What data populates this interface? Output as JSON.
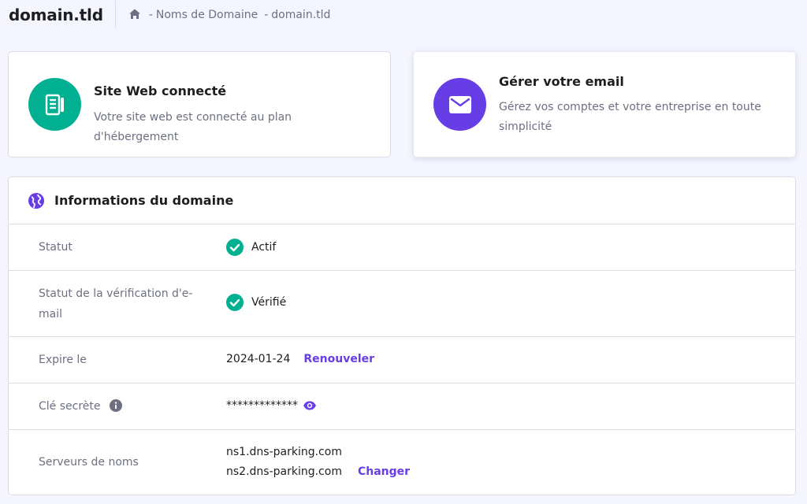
{
  "header": {
    "domain": "domain.tld",
    "breadcrumb": {
      "sep1": "-",
      "section": "Noms de Domaine",
      "sep2": "-",
      "current": "domain.tld"
    }
  },
  "cards": {
    "website": {
      "icon": "server-icon",
      "title": "Site Web connecté",
      "description": "Votre site web est connecté au plan d'hébergement"
    },
    "email": {
      "icon": "mail-icon",
      "title": "Gérer votre email",
      "description": "Gérez vos comptes et votre entreprise en toute simplicité"
    }
  },
  "domain_info": {
    "title": "Informations du domaine",
    "status": {
      "label": "Statut",
      "value": "Actif"
    },
    "email_verification": {
      "label": "Statut de la vérification d'e-mail",
      "value": "Vérifié"
    },
    "expiry": {
      "label": "Expire le",
      "value": "2024-01-24",
      "action": "Renouveler"
    },
    "secret_key": {
      "label": "Clé secrète",
      "value": "*************"
    },
    "nameservers": {
      "label": "Serveurs de noms",
      "ns1": "ns1.dns-parking.com",
      "ns2": "ns2.dns-parking.com",
      "action": "Changer"
    }
  },
  "colors": {
    "accent": "#673de6",
    "success": "#00b090",
    "background": "#f4f5ff"
  }
}
